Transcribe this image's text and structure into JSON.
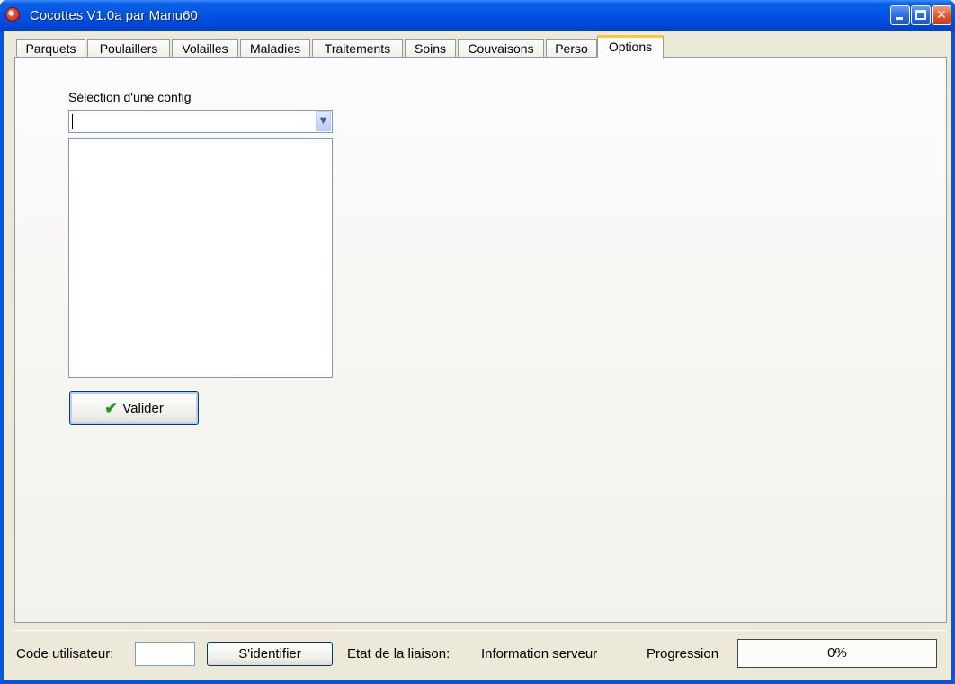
{
  "window": {
    "title": "Cocottes V1.0a par Manu60",
    "icons": {
      "app": "app-icon",
      "minimize": "minimize-icon",
      "maximize": "maximize-icon",
      "close": "close-icon"
    }
  },
  "tabs": [
    {
      "label": "Parquets",
      "active": false
    },
    {
      "label": "Poulaillers",
      "active": false
    },
    {
      "label": "Volailles",
      "active": false
    },
    {
      "label": "Maladies",
      "active": false
    },
    {
      "label": "Traitements",
      "active": false
    },
    {
      "label": "Soins",
      "active": false
    },
    {
      "label": "Couvaisons",
      "active": false
    },
    {
      "label": "Perso",
      "active": false
    },
    {
      "label": "Options",
      "active": true
    }
  ],
  "options_panel": {
    "config_label": "Sélection d'une config",
    "config_combo_value": "",
    "config_list_items": [],
    "validate_button_label": "Valider",
    "validate_icon": "checkmark-icon"
  },
  "statusbar": {
    "user_code_label": "Code utilisateur:",
    "user_code_value": "",
    "login_button_label": "S'identifier",
    "link_state_label": "Etat de la liaison:",
    "server_info_label": "Information serveur",
    "progress_label": "Progression",
    "progress_text": "0%",
    "progress_fraction": 0
  },
  "colors": {
    "titlebar": "#0055e5",
    "active_tab_highlight": "#ffc83c",
    "check_green": "#219a21"
  }
}
